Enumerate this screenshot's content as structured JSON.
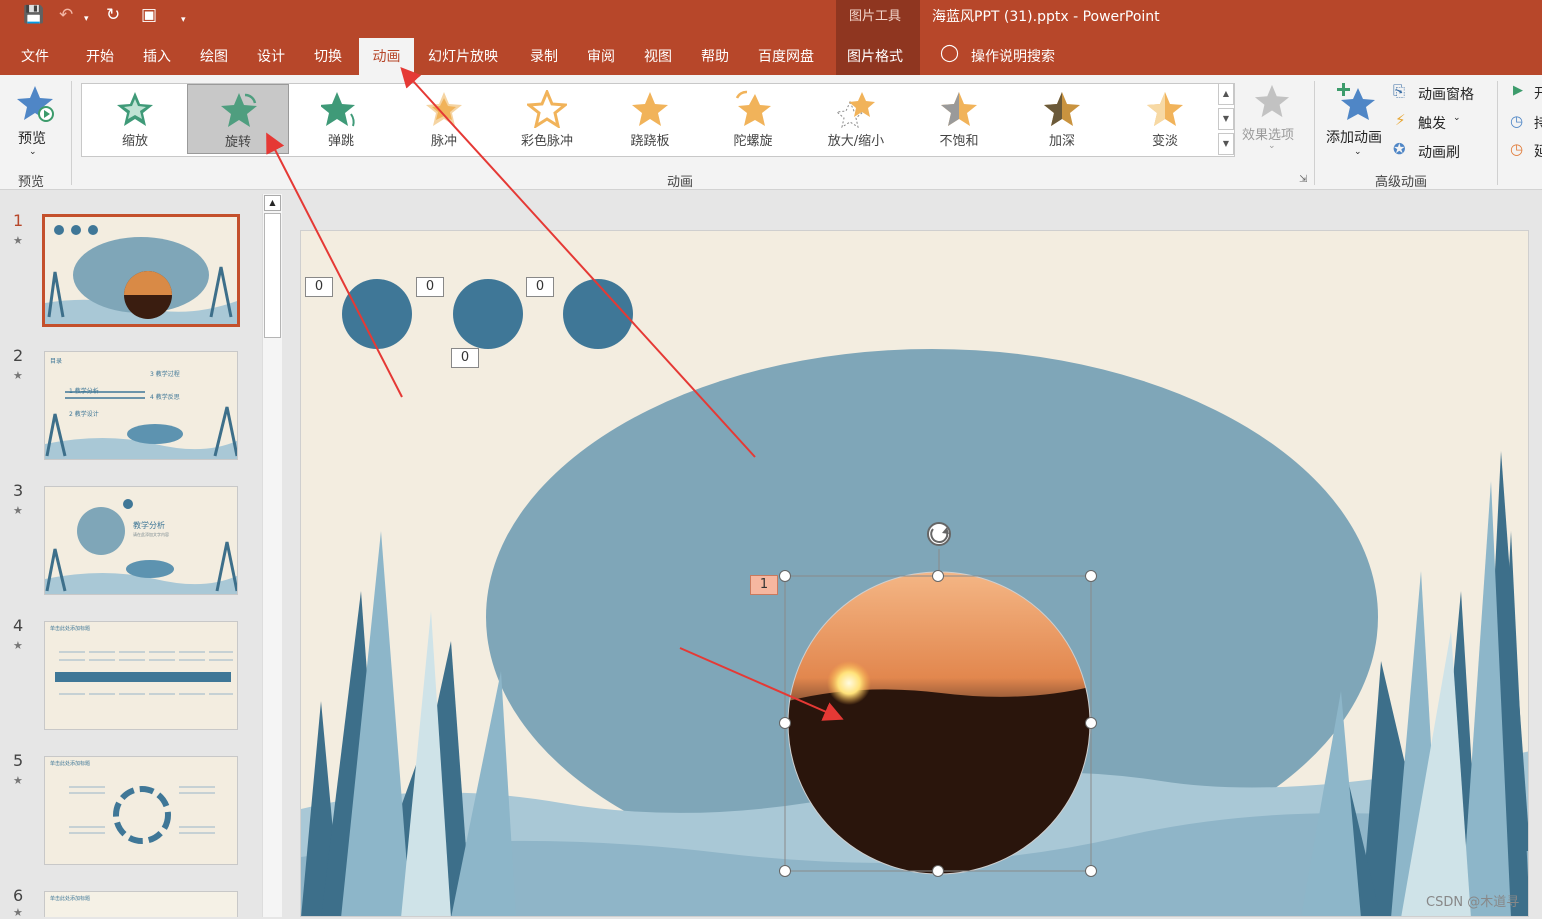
{
  "titlebar": {
    "context_group": "图片工具",
    "document_title": "海蓝风PPT (31).pptx  -  PowerPoint"
  },
  "tabs": {
    "file": "文件",
    "home": "开始",
    "insert": "插入",
    "draw": "绘图",
    "design": "设计",
    "transitions": "切换",
    "animations": "动画",
    "slideshow": "幻灯片放映",
    "record": "录制",
    "review": "审阅",
    "view": "视图",
    "help": "帮助",
    "baidu": "百度网盘",
    "picture_format": "图片格式",
    "tell_me": "操作说明搜索"
  },
  "ribbon": {
    "preview_button": "预览",
    "preview_group": "预览",
    "animation_group": "动画",
    "animations": [
      "缩放",
      "旋转",
      "弹跳",
      "脉冲",
      "彩色脉冲",
      "跷跷板",
      "陀螺旋",
      "放大/缩小",
      "不饱和",
      "加深",
      "变淡"
    ],
    "effect_options": "效果选项",
    "add_animation": "添加动画",
    "animation_pane": "动画窗格",
    "trigger": "触发",
    "animation_painter": "动画刷",
    "advanced_group": "高级动画",
    "partial": [
      "开",
      "持",
      "延"
    ]
  },
  "slides": {
    "numbers": [
      "1",
      "2",
      "3",
      "4",
      "5",
      "6"
    ]
  },
  "slide2": {
    "title": "目录",
    "items": [
      "1  教学分析",
      "2  教学设计",
      "3  教学过程",
      "4  教学反思"
    ]
  },
  "slide3": {
    "title": "教学分析",
    "caption": "请在此添加文字内容"
  },
  "slide4": {
    "title": "单击此处添加标题"
  },
  "slide5": {
    "title": "单击此处添加标题"
  },
  "slide6": {
    "title": "单击此处添加标题"
  },
  "canvas": {
    "tags": [
      "0",
      "0",
      "0",
      "0"
    ],
    "selected_tag": "1"
  },
  "watermark": "CSDN @木道寻",
  "colors": {
    "accent": "#b7472a",
    "slide_blue": "#3f7797",
    "ellipse": "#7fa6b8"
  }
}
